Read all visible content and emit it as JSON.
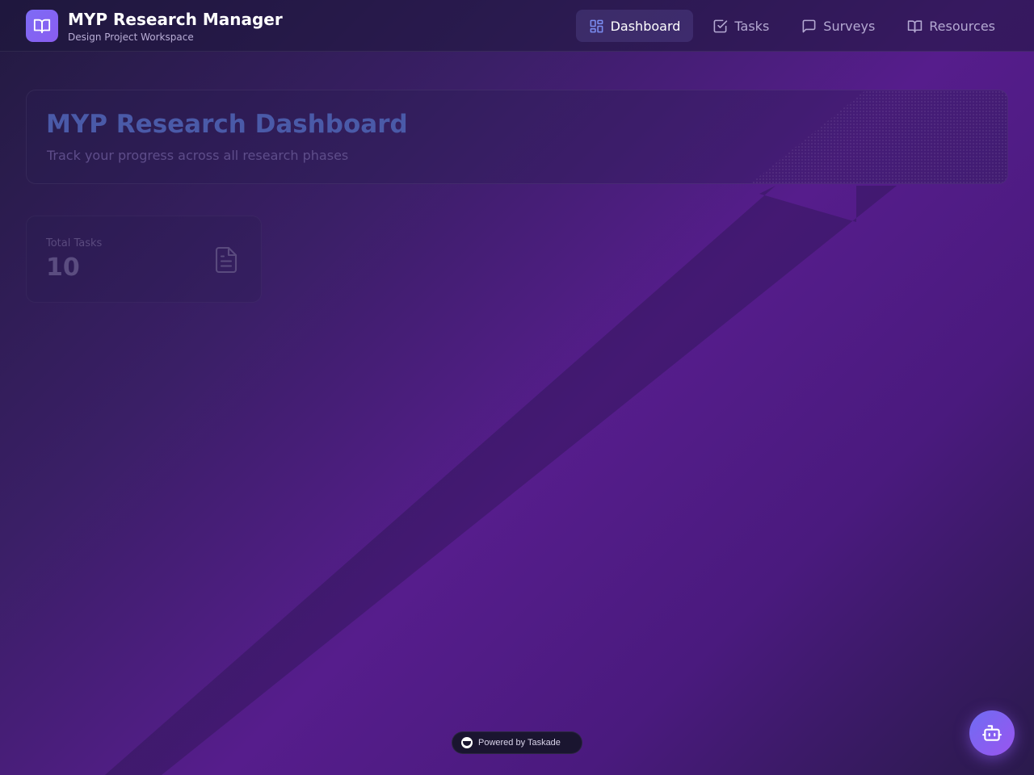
{
  "app": {
    "title": "MYP Research Manager",
    "subtitle": "Design Project Workspace",
    "logo_icon": "open-book-icon"
  },
  "nav": {
    "items": [
      {
        "label": "Dashboard",
        "icon": "dashboard-grid-icon",
        "active": true
      },
      {
        "label": "Tasks",
        "icon": "checkbox-icon",
        "active": false
      },
      {
        "label": "Surveys",
        "icon": "chat-bubble-icon",
        "active": false
      },
      {
        "label": "Resources",
        "icon": "book-icon",
        "active": false
      }
    ]
  },
  "hero": {
    "title": "MYP Research Dashboard",
    "subtitle": "Track your progress across all research phases"
  },
  "stats": [
    {
      "label": "Total Tasks",
      "value": "10",
      "icon": "document-icon"
    }
  ],
  "footer": {
    "powered_by": "Powered by Taskade"
  },
  "fab": {
    "icon": "robot-icon"
  },
  "colors": {
    "accent": "#7d6cf5",
    "header_bg": "#1e163c",
    "background_mid": "#561d8c",
    "hero_title": "#4a5aa8"
  }
}
